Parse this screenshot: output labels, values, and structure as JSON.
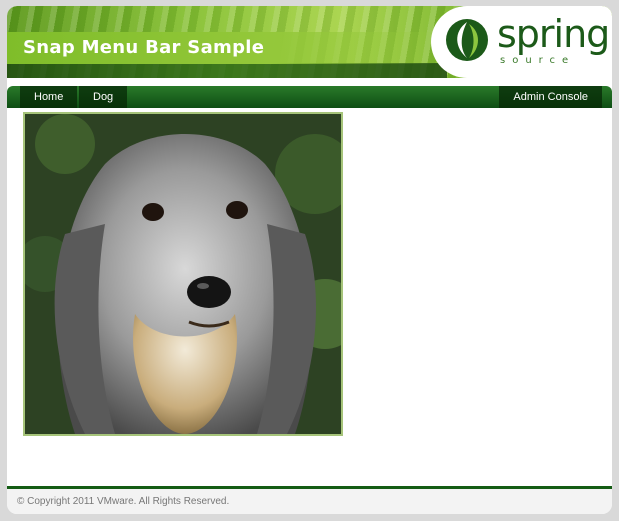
{
  "header": {
    "title": "Snap Menu Bar Sample",
    "logo": {
      "text": "spring",
      "subtext": "source"
    }
  },
  "menu": {
    "items": [
      {
        "label": "Home"
      },
      {
        "label": "Dog"
      }
    ],
    "admin_label": "Admin Console"
  },
  "content": {
    "image_subject": "dog-photo"
  },
  "footer": {
    "copyright": "© Copyright 2011 VMware. All Rights Reserved."
  },
  "colors": {
    "brand_green": "#1c5a19",
    "header_green": "#86c032",
    "menu_dark": "#0e4e14",
    "photo_border": "#a6c47a"
  }
}
